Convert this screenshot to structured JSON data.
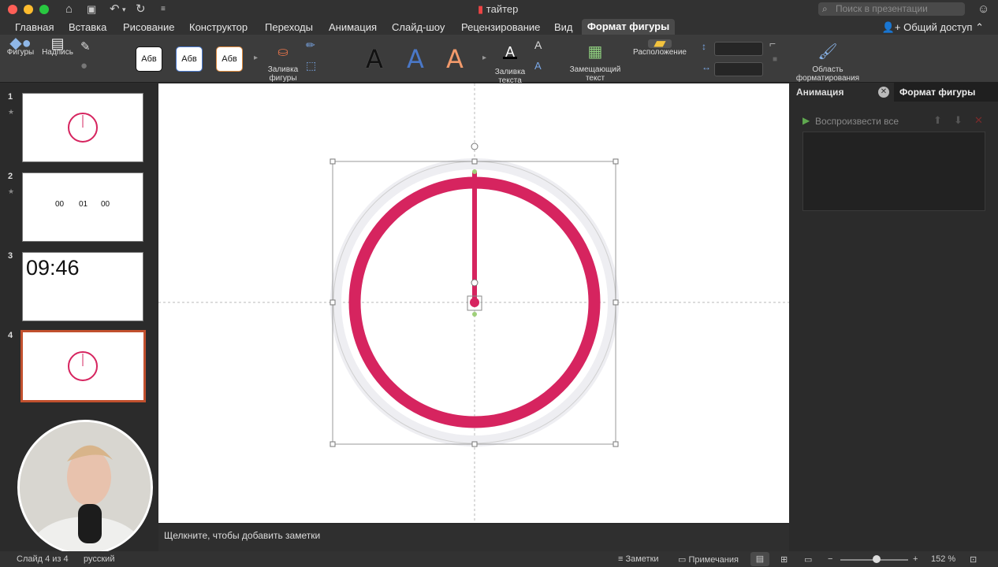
{
  "colors": {
    "accent": "#d6245f",
    "active_tab_bg": "#4a4a4a",
    "selection": "#c1502e"
  },
  "titlebar": {
    "doc_title": "тайтер",
    "search_placeholder": "Поиск в презентации"
  },
  "menu": {
    "tabs": [
      "Главная",
      "Вставка",
      "Рисование",
      "Конструктор",
      "Переходы",
      "Анимация",
      "Слайд-шоу",
      "Рецензирование",
      "Вид"
    ],
    "active_tab": "Формат фигуры",
    "share": "Общий доступ"
  },
  "ribbon": {
    "shapes": "Фигуры",
    "textbox": "Надпись",
    "style_label": "Абв",
    "shape_fill": "Заливка\nфигуры",
    "text_fill": "Заливка\nтекста",
    "alt_text": "Замещающий\nтекст",
    "arrange": "Расположение",
    "format_pane": "Область\nформатирования",
    "wordart_letter": "A"
  },
  "slides": [
    {
      "num": "1",
      "starred": true
    },
    {
      "num": "2",
      "starred": true,
      "content": [
        "00",
        "01",
        "00"
      ]
    },
    {
      "num": "3",
      "starred": false,
      "content": "09:46"
    },
    {
      "num": "4",
      "starred": false,
      "selected": true
    }
  ],
  "notes_placeholder": "Щелкните, чтобы добавить заметки",
  "right_panel": {
    "tab_animation": "Анимация",
    "tab_format": "Формат фигуры",
    "play_all": "Воспроизвести все"
  },
  "status": {
    "slide_info": "Слайд 4 из 4",
    "language": "русский",
    "notes": "Заметки",
    "comments": "Примечания",
    "zoom": "152 %",
    "zoom_level": 0.53
  }
}
